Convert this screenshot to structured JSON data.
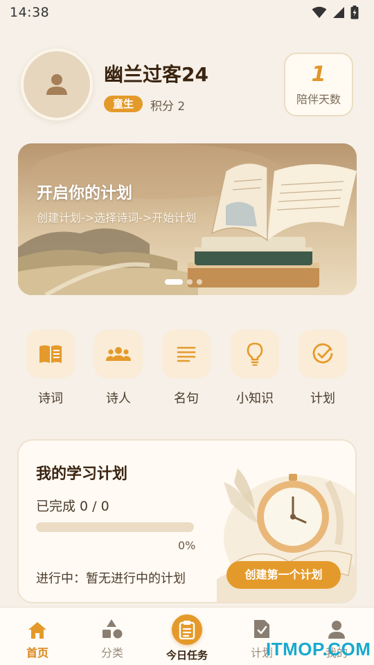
{
  "status_bar": {
    "time": "14:38"
  },
  "profile": {
    "username": "幽兰过客24",
    "level": "童生",
    "points": "积分 2",
    "days_value": "1",
    "days_label": "陪伴天数"
  },
  "banner": {
    "title": "开启你的计划",
    "subtitle": "创建计划->选择诗词->开始计划",
    "slide_count": 3,
    "active_slide": 1
  },
  "categories": [
    {
      "label": "诗词",
      "icon": "book-open-icon"
    },
    {
      "label": "诗人",
      "icon": "people-icon"
    },
    {
      "label": "名句",
      "icon": "lines-icon"
    },
    {
      "label": "小知识",
      "icon": "lightbulb-icon"
    },
    {
      "label": "计划",
      "icon": "check-circle-icon"
    }
  ],
  "plan": {
    "title": "我的学习计划",
    "completed": "已完成 0 / 0",
    "progress": 0,
    "progress_text": "0%",
    "status": "进行中：暂无进行中的计划",
    "create_button": "创建第一个计划"
  },
  "nav": {
    "home": "首页",
    "category": "分类",
    "today": "今日任务",
    "plan": "计划",
    "mine": "我的"
  },
  "watermark": "ITMOP.COM",
  "colors": {
    "accent": "#e49a2b",
    "background": "#f6f0e8",
    "card": "#fffaf3"
  }
}
